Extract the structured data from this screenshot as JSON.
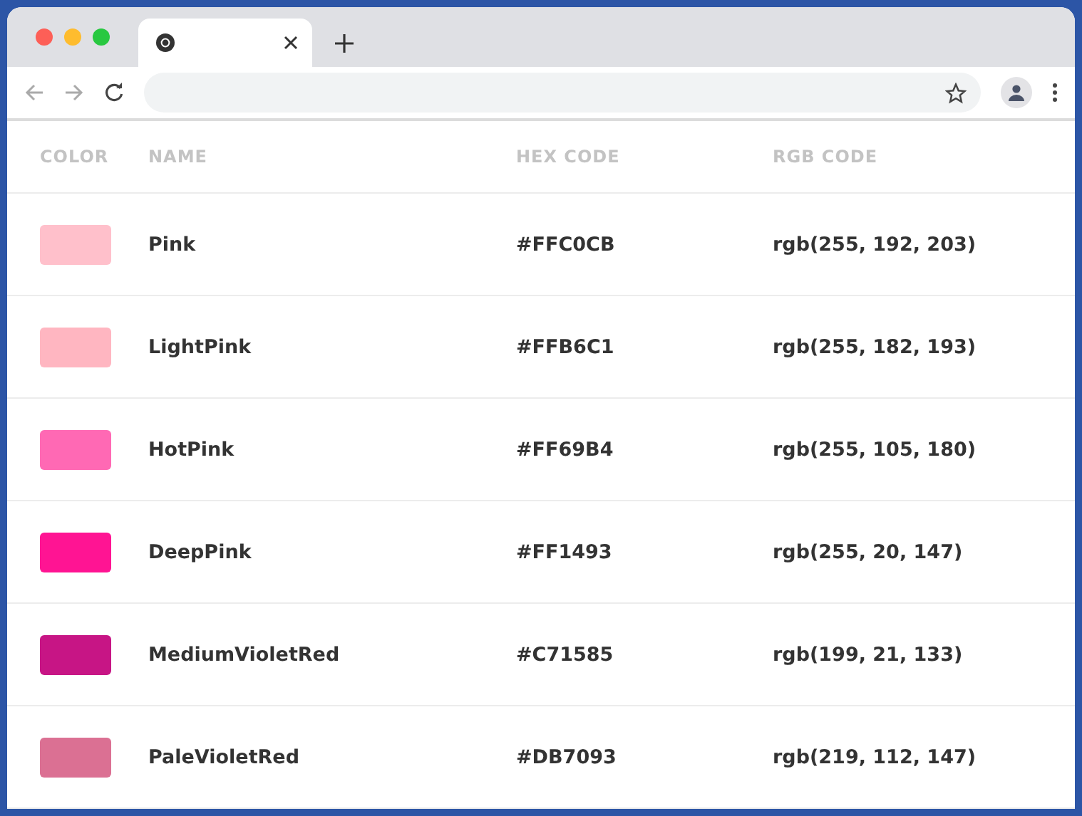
{
  "table": {
    "columns": [
      "COLOR",
      "NAME",
      "HEX CODE",
      "RGB CODE"
    ],
    "rows": [
      {
        "color": "#ffc0cb",
        "name": "Pink",
        "hex": "#FFC0CB",
        "rgb": "rgb(255, 192, 203)"
      },
      {
        "color": "#ffb6c1",
        "name": "LightPink",
        "hex": "#FFB6C1",
        "rgb": "rgb(255, 182, 193)"
      },
      {
        "color": "#ff69b4",
        "name": "HotPink",
        "hex": "#FF69B4",
        "rgb": "rgb(255, 105, 180)"
      },
      {
        "color": "#ff1493",
        "name": "DeepPink",
        "hex": "#FF1493",
        "rgb": "rgb(255, 20, 147)"
      },
      {
        "color": "#c71585",
        "name": "MediumVioletRed",
        "hex": "#C71585",
        "rgb": "rgb(199, 21, 133)"
      },
      {
        "color": "#db7093",
        "name": "PaleVioletRed",
        "hex": "#DB7093",
        "rgb": "rgb(219, 112, 147)"
      }
    ]
  }
}
